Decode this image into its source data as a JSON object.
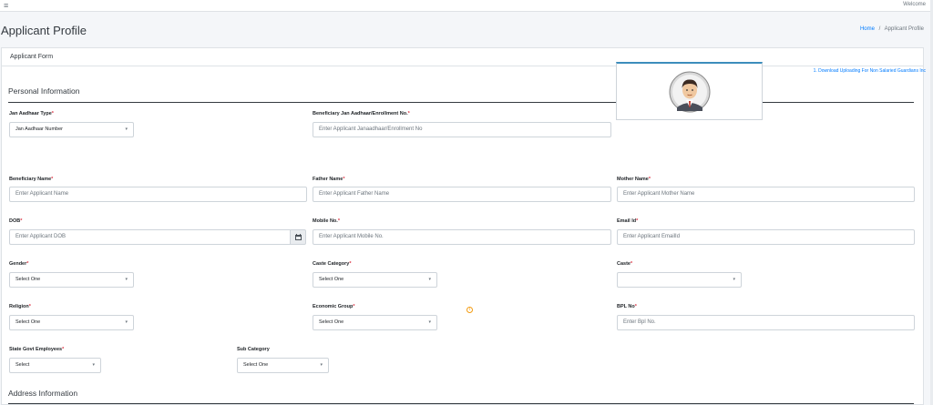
{
  "topbar": {
    "menu_icon": "hamburger-icon",
    "welcome": "Welcome"
  },
  "page": {
    "title": "Applicant Profile"
  },
  "breadcrumb": {
    "home": "Home",
    "separator": "/",
    "current": "Applicant Profile"
  },
  "card": {
    "header": "Applicant Form",
    "download_link": "1. Download Uploading For Non Salaried Guardians Inc"
  },
  "sections": {
    "personal": "Personal Information",
    "address": "Address Information"
  },
  "fields": {
    "jan_aadhaar_type": {
      "label": "Jan Aadhaar Type",
      "value": "Jan Aadhaar Number"
    },
    "beneficiary_jan_aadhaar": {
      "label": "Beneficiary Jan Aadhaar/Enrollment No.",
      "placeholder": "Enter Applicant Janaadhaar/Enrollment No"
    },
    "beneficiary_name": {
      "label": "Beneficiary Name",
      "placeholder": "Enter Applicant Name"
    },
    "father_name": {
      "label": "Father Name",
      "placeholder": "Enter Applicant Father Name"
    },
    "mother_name": {
      "label": "Mother Name",
      "placeholder": "Enter Applicant Mother Name"
    },
    "dob": {
      "label": "DOB",
      "placeholder": "Enter Applicant DOB"
    },
    "mobile": {
      "label": "Mobile No.",
      "placeholder": "Enter Applicant Mobile No."
    },
    "email": {
      "label": "Email Id",
      "placeholder": "Enter Applicant EmailId"
    },
    "gender": {
      "label": "Gender",
      "value": "Select One"
    },
    "caste_category": {
      "label": "Caste Category",
      "value": "Select One"
    },
    "caste": {
      "label": "Caste",
      "value": ""
    },
    "religion": {
      "label": "Religion",
      "value": "Select One"
    },
    "economic_group": {
      "label": "Economic Group",
      "value": "Select One"
    },
    "bpl_no": {
      "label": "BPL No",
      "placeholder": "Enter Bpl No."
    },
    "state_govt_employees": {
      "label": "State Govt Employees",
      "value": "Select"
    },
    "sub_category": {
      "label": "Sub Category",
      "value": "Select One"
    }
  },
  "required_mark": "*",
  "caret": "▾",
  "colors": {
    "accent": "#007bff",
    "required": "#dc3545",
    "photo_border": "#3c8dbc",
    "info_icon": "#f39c12"
  }
}
